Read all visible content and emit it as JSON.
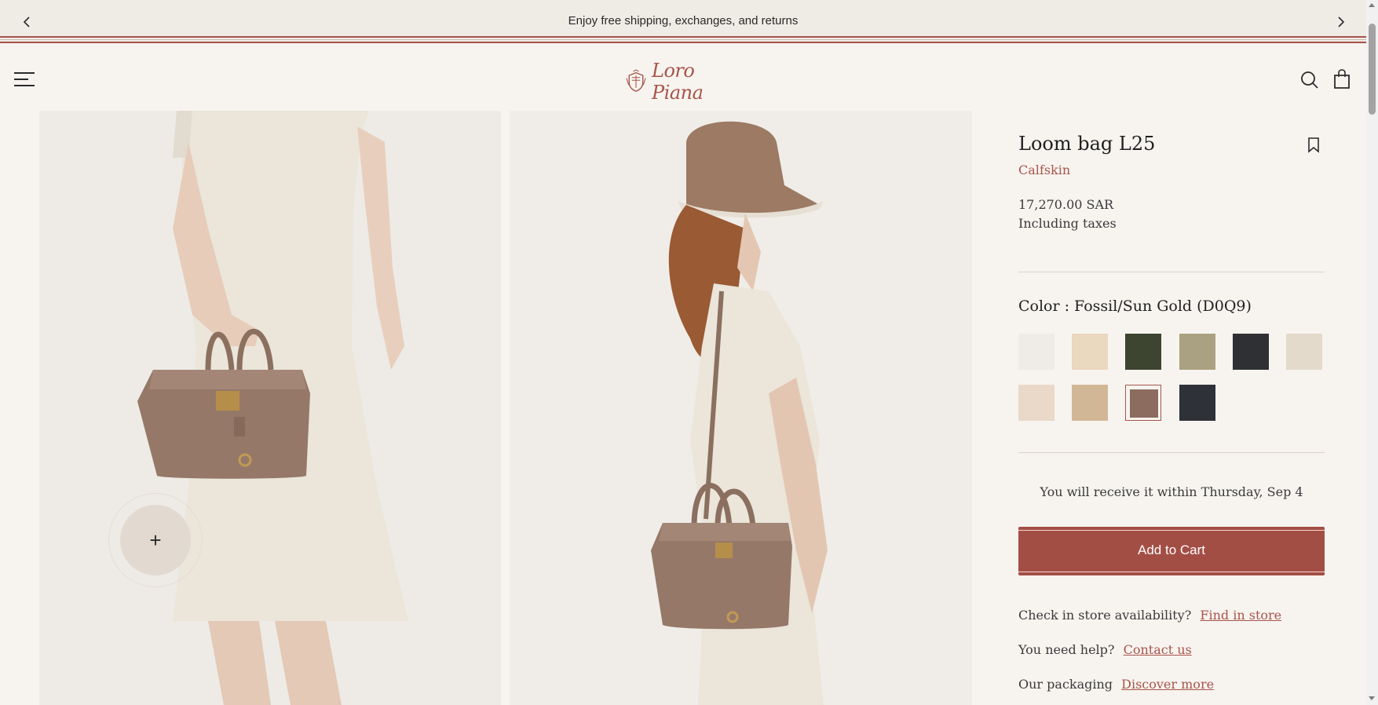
{
  "announcement": {
    "message": "Enjoy free shipping, exchanges, and returns"
  },
  "header": {
    "logo_text": "Loro Piana",
    "brand_color": "#a8544a"
  },
  "gallery": {
    "zoom_label": "+"
  },
  "product": {
    "title": "Loom bag L25",
    "material": "Calfskin",
    "price": "17,270.00 SAR",
    "tax_note": "Including taxes",
    "color_label": "Color : Fossil/Sun Gold (D0Q9)",
    "swatches": [
      {
        "color": "#efebe6",
        "selected": false
      },
      {
        "color": "#ead8bf",
        "selected": false
      },
      {
        "color": "#3d4430",
        "selected": false
      },
      {
        "color": "#aaa182",
        "selected": false
      },
      {
        "color": "#2e3034",
        "selected": false
      },
      {
        "color": "#e3dacb",
        "selected": false
      },
      {
        "color": "#ead9c8",
        "selected": false
      },
      {
        "color": "#d2b796",
        "selected": false
      },
      {
        "color": "#8c6c5f",
        "selected": true
      },
      {
        "color": "#2e3138",
        "selected": false
      }
    ],
    "delivery": "You will receive it within Thursday, Sep 4",
    "add_to_cart": "Add to Cart",
    "store_question": "Check in store availability?",
    "store_link": "Find in store",
    "help_question": "You need help?",
    "help_link": "Contact us",
    "packaging_label": "Our packaging",
    "packaging_link": "Discover more"
  }
}
